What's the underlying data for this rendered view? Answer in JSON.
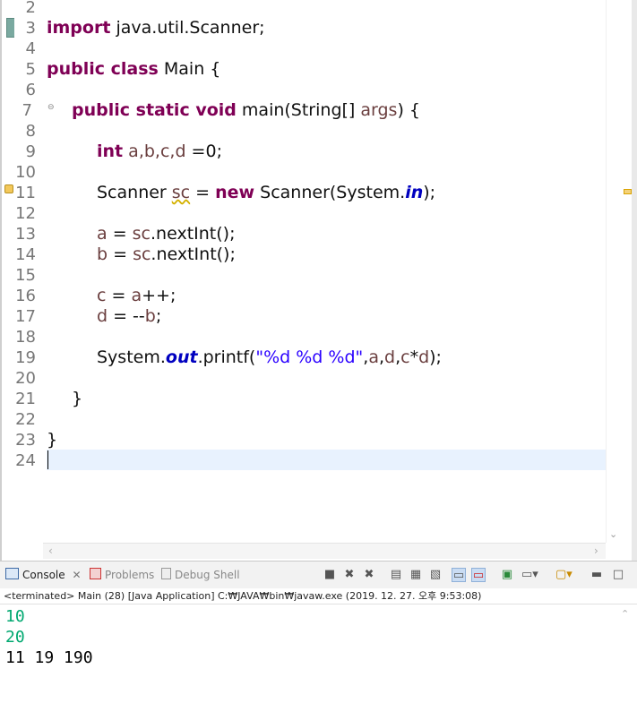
{
  "editor": {
    "line_numbers": [
      "2",
      "3",
      "4",
      "5",
      "6",
      "7",
      "8",
      "9",
      "10",
      "11",
      "12",
      "13",
      "14",
      "15",
      "16",
      "17",
      "18",
      "19",
      "20",
      "21",
      "22",
      "23",
      "24"
    ],
    "lines": {
      "l3_kw": "import",
      "l3_rest": " java.util.Scanner;",
      "l5_kw": "public class",
      "l5_rest": " Main {",
      "l7_kw": "public static void",
      "l7_a": " main(String[] ",
      "l7_var": "args",
      "l7_b": ") {",
      "l9_kw": "int",
      "l9_a": " ",
      "l9_vars": "a,b,c,d",
      "l9_b": " =0;",
      "l11_a": "Scanner ",
      "l11_var": "sc",
      "l11_b": " = ",
      "l11_kw": "new",
      "l11_c": " Scanner(System.",
      "l11_field": "in",
      "l11_d": ");",
      "l13_var1": "a",
      "l13_a": " = ",
      "l13_var2": "sc",
      "l13_b": ".nextInt();",
      "l14_var1": "b",
      "l14_a": " = ",
      "l14_var2": "sc",
      "l14_b": ".nextInt();",
      "l16_var1": "c",
      "l16_a": " = ",
      "l16_var2": "a",
      "l16_b": "++;",
      "l17_var1": "d",
      "l17_a": " = --",
      "l17_var2": "b",
      "l17_b": ";",
      "l19_a": "System.",
      "l19_field": "out",
      "l19_b": ".printf(",
      "l19_str": "\"%d %d %d\"",
      "l19_c": ",",
      "l19_v1": "a",
      "l19_d": ",",
      "l19_v2": "d",
      "l19_e": ",",
      "l19_v3": "c",
      "l19_f": "*",
      "l19_v4": "d",
      "l19_g": ");",
      "l21": "}",
      "l23": "}"
    },
    "colors": {
      "keyword": "#7f0055",
      "string": "#2a00ff",
      "static_field": "#0000c0",
      "local_variable": "#6a3e3e",
      "current_line": "#e8f2fe"
    }
  },
  "console": {
    "tabs": {
      "console": "Console",
      "problems": "Problems",
      "debug_shell": "Debug Shell"
    },
    "status": "<terminated> Main (28) [Java Application] C:₩JAVA₩bin₩javaw.exe (2019. 12. 27. 오후 9:53:08)",
    "output": {
      "input1": "10",
      "input2": "20",
      "result": "11 19 190"
    },
    "colors": {
      "input": "#00a870"
    }
  }
}
